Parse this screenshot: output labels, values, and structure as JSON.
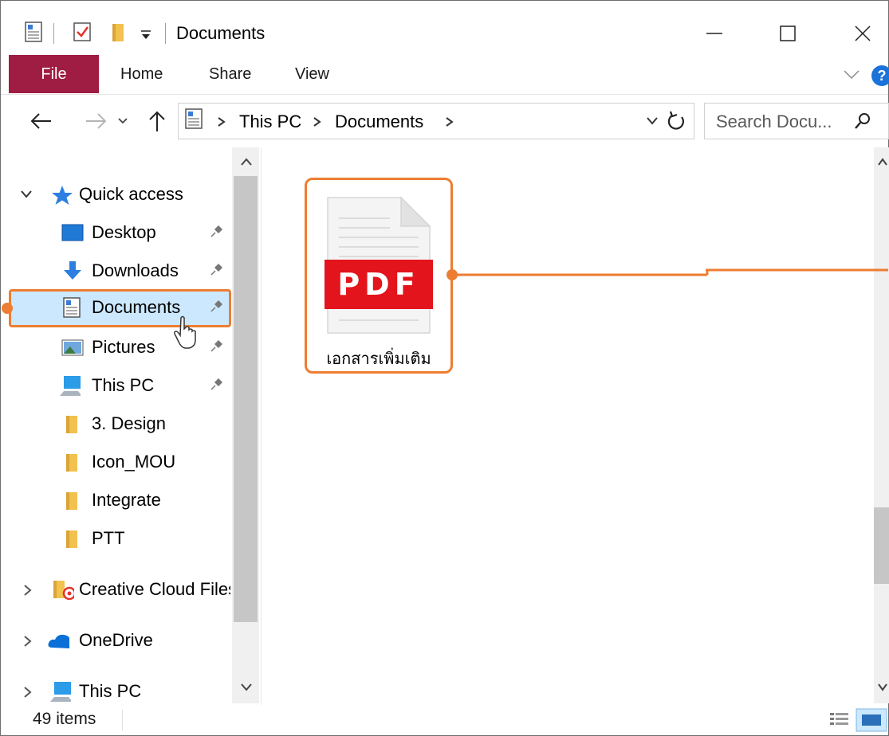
{
  "window": {
    "title": "Documents",
    "icons": [
      "document-icon",
      "properties-check-icon",
      "folder-icon",
      "quick-access-dropdown-icon"
    ],
    "controls": [
      "minimize-icon",
      "maximize-icon",
      "close-icon"
    ]
  },
  "ribbon": {
    "tabs": [
      "File",
      "Home",
      "Share",
      "View"
    ],
    "help_label": "?"
  },
  "address": {
    "crumbs": [
      "This PC",
      "Documents"
    ],
    "search_placeholder": "Search Docu..."
  },
  "nav": {
    "quick_access_label": "Quick access",
    "quick_items": [
      {
        "label": "Desktop",
        "icon": "desktop-icon",
        "pinned": true
      },
      {
        "label": "Downloads",
        "icon": "download-arrow-icon",
        "pinned": true
      },
      {
        "label": "Documents",
        "icon": "documents-icon",
        "pinned": true,
        "selected": true
      },
      {
        "label": "Pictures",
        "icon": "pictures-icon",
        "pinned": true
      },
      {
        "label": "This PC",
        "icon": "computer-icon",
        "pinned": true
      },
      {
        "label": "3. Design",
        "icon": "folder-icon",
        "pinned": false
      },
      {
        "label": "Icon_MOU",
        "icon": "folder-icon",
        "pinned": false
      },
      {
        "label": "Integrate",
        "icon": "folder-icon",
        "pinned": false
      },
      {
        "label": "PTT",
        "icon": "folder-icon",
        "pinned": false
      }
    ],
    "roots": [
      {
        "label": "Creative Cloud Files",
        "icon": "creative-cloud-icon"
      },
      {
        "label": "OneDrive",
        "icon": "cloud-icon"
      },
      {
        "label": "This PC",
        "icon": "computer-icon"
      }
    ]
  },
  "content": {
    "files": [
      {
        "name": "เอกสารเพิ่มเติม",
        "badge": "PDF",
        "type_color": "#e3141b"
      }
    ]
  },
  "status": {
    "item_count": "49 items"
  },
  "colors": {
    "accent": "#ed7d31",
    "file_tab": "#9f1c42",
    "selection": "#cce8ff",
    "pdf_red": "#e3141b"
  }
}
